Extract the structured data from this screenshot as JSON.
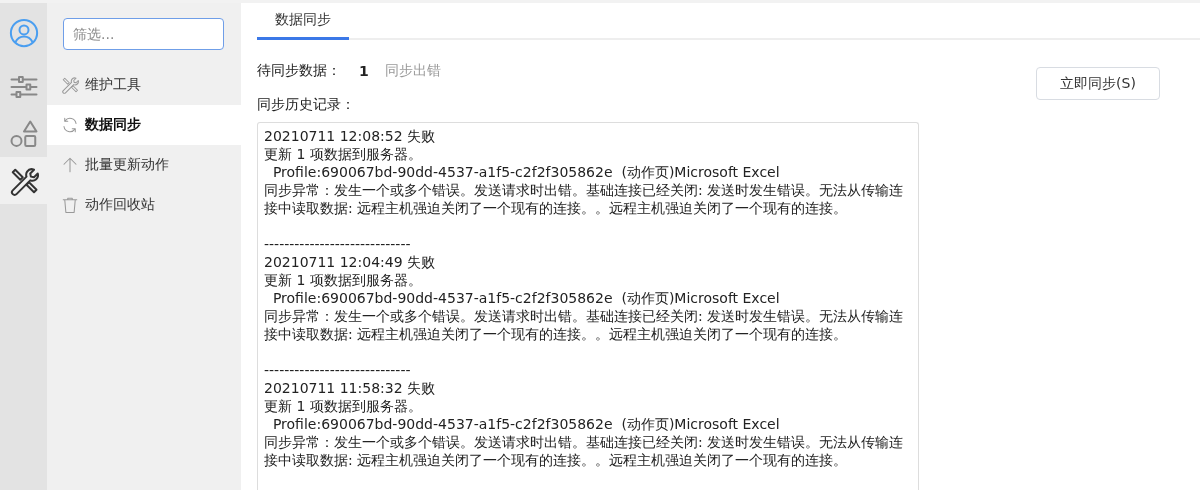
{
  "avatar": {
    "kind": "user"
  },
  "rail": [
    {
      "kind": "sliders",
      "selected": false
    },
    {
      "kind": "shapes",
      "selected": false
    },
    {
      "kind": "tools",
      "selected": true
    }
  ],
  "sidebar": {
    "filter": {
      "placeholder": "筛选..."
    },
    "items": [
      {
        "kind": "tools",
        "label": "维护工具",
        "selected": false
      },
      {
        "kind": "sync",
        "label": "数据同步",
        "selected": true
      },
      {
        "kind": "upload",
        "label": "批量更新动作",
        "selected": false
      },
      {
        "kind": "trash",
        "label": "动作回收站",
        "selected": false
      }
    ]
  },
  "tabs": [
    {
      "label": "数据同步",
      "selected": true
    }
  ],
  "pending": {
    "label": "待同步数据：",
    "count": "1",
    "link": "同步出错"
  },
  "history_label": "同步历史记录：",
  "sync_button": "立即同步(S)",
  "log": [
    {
      "header": "20210711 12:08:52 失败",
      "lines": [
        "更新 1 项数据到服务器。",
        "  Profile:690067bd-90dd-4537-a1f5-c2f2f305862e  (动作页)Microsoft Excel",
        "同步异常：发生一个或多个错误。发送请求时出错。基础连接已经关闭: 发送时发生错误。无法从传输连接中读取数据: 远程主机强迫关闭了一个现有的连接。。远程主机强迫关闭了一个现有的连接。"
      ]
    },
    {
      "separator": "-----------------------------",
      "header": "20210711 12:04:49 失败",
      "lines": [
        "更新 1 项数据到服务器。",
        "  Profile:690067bd-90dd-4537-a1f5-c2f2f305862e  (动作页)Microsoft Excel",
        "同步异常：发生一个或多个错误。发送请求时出错。基础连接已经关闭: 发送时发生错误。无法从传输连接中读取数据: 远程主机强迫关闭了一个现有的连接。。远程主机强迫关闭了一个现有的连接。"
      ]
    },
    {
      "separator": "-----------------------------",
      "header": "20210711 11:58:32 失败",
      "lines": [
        "更新 1 项数据到服务器。",
        "  Profile:690067bd-90dd-4537-a1f5-c2f2f305862e  (动作页)Microsoft Excel",
        "同步异常：发生一个或多个错误。发送请求时出错。基础连接已经关闭: 发送时发生错误。无法从传输连接中读取数据: 远程主机强迫关闭了一个现有的连接。。远程主机强迫关闭了一个现有的连接。"
      ]
    }
  ]
}
